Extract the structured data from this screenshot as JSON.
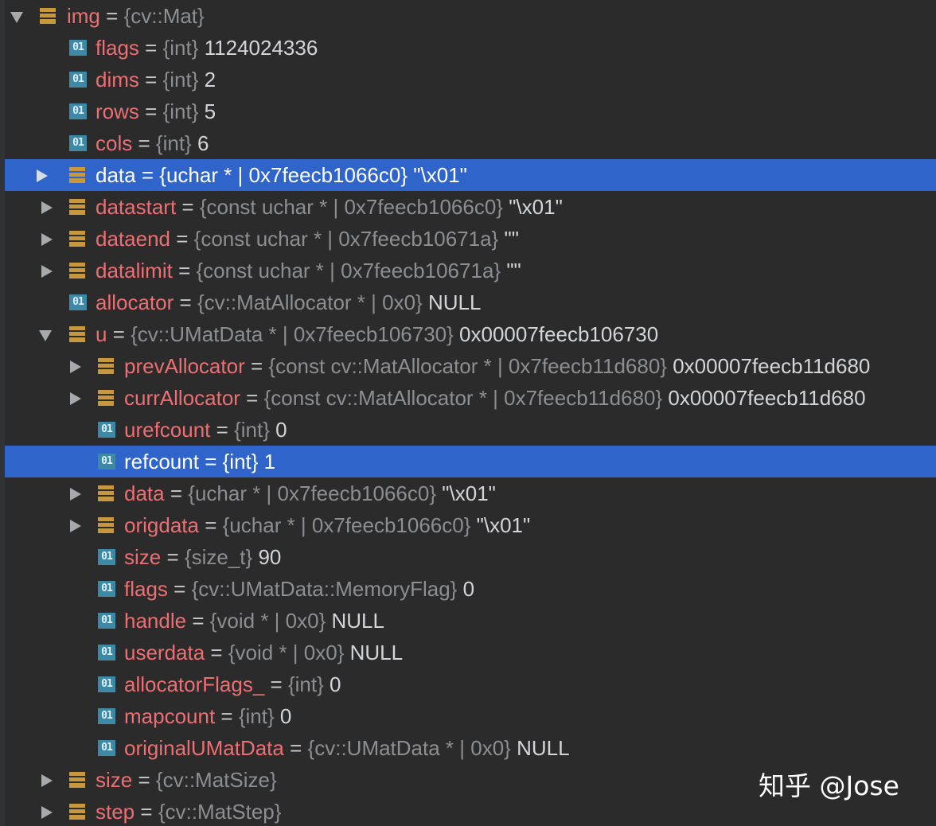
{
  "tree": {
    "rows": [
      {
        "name": "img",
        "type": "{cv::Mat}",
        "value": "",
        "expander": "expanded",
        "icon": "struct-icon",
        "depth": 0,
        "selected": false
      },
      {
        "name": "flags",
        "type": "{int}",
        "value": "1124024336",
        "expander": "none",
        "icon": "primitive-icon",
        "depth": 1,
        "selected": false
      },
      {
        "name": "dims",
        "type": "{int}",
        "value": "2",
        "expander": "none",
        "icon": "primitive-icon",
        "depth": 1,
        "selected": false
      },
      {
        "name": "rows",
        "type": "{int}",
        "value": "5",
        "expander": "none",
        "icon": "primitive-icon",
        "depth": 1,
        "selected": false
      },
      {
        "name": "cols",
        "type": "{int}",
        "value": "6",
        "expander": "none",
        "icon": "primitive-icon",
        "depth": 1,
        "selected": false
      },
      {
        "name": "data",
        "type": "{uchar * | 0x7feecb1066c0}",
        "value": "\"\\x01\"",
        "expander": "collapsed",
        "icon": "struct-icon",
        "depth": 1,
        "selected": true
      },
      {
        "name": "datastart",
        "type": "{const uchar * | 0x7feecb1066c0}",
        "value": "\"\\x01\"",
        "expander": "collapsed",
        "icon": "struct-icon",
        "depth": 1,
        "selected": false
      },
      {
        "name": "dataend",
        "type": "{const uchar * | 0x7feecb10671a}",
        "value": "\"\"",
        "expander": "collapsed",
        "icon": "struct-icon",
        "depth": 1,
        "selected": false
      },
      {
        "name": "datalimit",
        "type": "{const uchar * | 0x7feecb10671a}",
        "value": "\"\"",
        "expander": "collapsed",
        "icon": "struct-icon",
        "depth": 1,
        "selected": false
      },
      {
        "name": "allocator",
        "type": "{cv::MatAllocator * | 0x0}",
        "value": "NULL",
        "expander": "none",
        "icon": "primitive-icon",
        "depth": 1,
        "selected": false
      },
      {
        "name": "u",
        "type": "{cv::UMatData * | 0x7feecb106730}",
        "value": "0x00007feecb106730",
        "expander": "expanded",
        "icon": "struct-icon",
        "depth": 1,
        "selected": false
      },
      {
        "name": "prevAllocator",
        "type": "{const cv::MatAllocator * | 0x7feecb11d680}",
        "value": "0x00007feecb11d680",
        "expander": "collapsed",
        "icon": "struct-icon",
        "depth": 2,
        "selected": false
      },
      {
        "name": "currAllocator",
        "type": "{const cv::MatAllocator * | 0x7feecb11d680}",
        "value": "0x00007feecb11d680",
        "expander": "collapsed",
        "icon": "struct-icon",
        "depth": 2,
        "selected": false
      },
      {
        "name": "urefcount",
        "type": "{int}",
        "value": "0",
        "expander": "none",
        "icon": "primitive-icon",
        "depth": 2,
        "selected": false
      },
      {
        "name": "refcount",
        "type": "{int}",
        "value": "1",
        "expander": "none",
        "icon": "primitive-icon",
        "depth": 2,
        "selected": true
      },
      {
        "name": "data",
        "type": "{uchar * | 0x7feecb1066c0}",
        "value": "\"\\x01\"",
        "expander": "collapsed",
        "icon": "struct-icon",
        "depth": 2,
        "selected": false
      },
      {
        "name": "origdata",
        "type": "{uchar * | 0x7feecb1066c0}",
        "value": "\"\\x01\"",
        "expander": "collapsed",
        "icon": "struct-icon",
        "depth": 2,
        "selected": false
      },
      {
        "name": "size",
        "type": "{size_t}",
        "value": "90",
        "expander": "none",
        "icon": "primitive-icon",
        "depth": 2,
        "selected": false
      },
      {
        "name": "flags",
        "type": "{cv::UMatData::MemoryFlag}",
        "value": "0",
        "expander": "none",
        "icon": "primitive-icon",
        "depth": 2,
        "selected": false
      },
      {
        "name": "handle",
        "type": "{void * | 0x0}",
        "value": "NULL",
        "expander": "none",
        "icon": "primitive-icon",
        "depth": 2,
        "selected": false
      },
      {
        "name": "userdata",
        "type": "{void * | 0x0}",
        "value": "NULL",
        "expander": "none",
        "icon": "primitive-icon",
        "depth": 2,
        "selected": false
      },
      {
        "name": "allocatorFlags_",
        "type": "{int}",
        "value": "0",
        "expander": "none",
        "icon": "primitive-icon",
        "depth": 2,
        "selected": false
      },
      {
        "name": "mapcount",
        "type": "{int}",
        "value": "0",
        "expander": "none",
        "icon": "primitive-icon",
        "depth": 2,
        "selected": false
      },
      {
        "name": "originalUMatData",
        "type": "{cv::UMatData * | 0x0}",
        "value": "NULL",
        "expander": "none",
        "icon": "primitive-icon",
        "depth": 2,
        "selected": false
      },
      {
        "name": "size",
        "type": "{cv::MatSize}",
        "value": "",
        "expander": "collapsed",
        "icon": "struct-icon",
        "depth": 1,
        "selected": false
      },
      {
        "name": "step",
        "type": "{cv::MatStep}",
        "value": "",
        "expander": "collapsed",
        "icon": "struct-icon",
        "depth": 1,
        "selected": false
      }
    ],
    "equals_sign": "=",
    "primitive_icon_label": "01"
  },
  "watermark": {
    "text": "知乎 @Jose"
  },
  "colors": {
    "background": "#2b2b2b",
    "selection": "#2f65ca",
    "name": "#ec6f73",
    "type": "#8c8e91",
    "value": "#d3d5d8",
    "struct_icon": "#c9983a",
    "primitive_icon": "#3d8aa8"
  }
}
